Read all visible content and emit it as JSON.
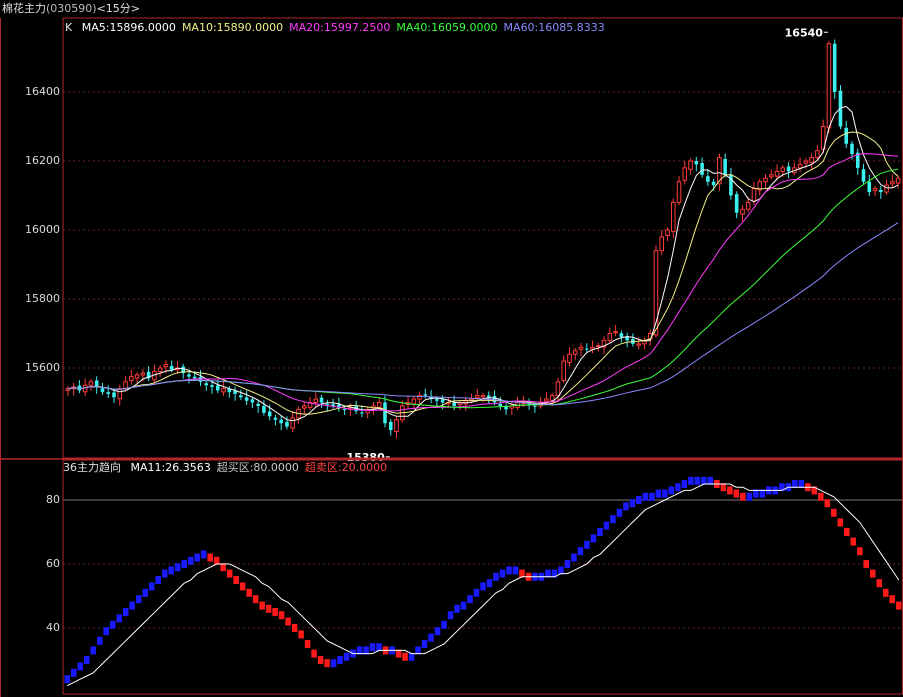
{
  "window": {
    "name": "棉花主力",
    "code": "(030590)",
    "period": "<15分>"
  },
  "colors": {
    "background": "#000000",
    "frame": "#b0262a",
    "grid": "#6e2020",
    "up": "#ff3b3b",
    "down": "#3cf0f0",
    "ma5": "#ffffff",
    "ma10": "#f5f18a",
    "ma20": "#ff3cff",
    "ma40": "#3cff3c",
    "ma60": "#8a8aff",
    "ind_up": "#1a1aff",
    "ind_down": "#ff1a1a",
    "ind_ma": "#ffffff"
  },
  "main_panel": {
    "label": "K",
    "ma_legend": [
      {
        "text": "MA5:15896.0000",
        "color": "#ffffff"
      },
      {
        "text": "MA10:15890.0000",
        "color": "#f5f18a"
      },
      {
        "text": "MA20:15997.2500",
        "color": "#ff3cff"
      },
      {
        "text": "MA40:16059.0000",
        "color": "#3cff3c"
      },
      {
        "text": "MA60:16085.8333",
        "color": "#8a8aff"
      }
    ],
    "high_marker": "16540",
    "low_marker": "15380"
  },
  "sub_panel": {
    "label": "36主力趋向",
    "legend": [
      {
        "text": "MA11:26.3563",
        "color": "#ffffff"
      },
      {
        "text": "超买区:80.0000",
        "color": "#c8c8c8"
      },
      {
        "text": "超卖区:20.0000",
        "color": "#ff4040"
      }
    ]
  },
  "chart_data": [
    {
      "type": "candlestick",
      "title": "",
      "ylim": [
        15380,
        16540
      ],
      "yticks": [
        15600,
        15800,
        16000,
        16200,
        16400
      ],
      "grid": true,
      "close": [
        15540,
        15545,
        15535,
        15550,
        15560,
        15545,
        15530,
        15525,
        15515,
        15540,
        15560,
        15575,
        15580,
        15585,
        15570,
        15590,
        15600,
        15610,
        15595,
        15600,
        15585,
        15575,
        15570,
        15560,
        15550,
        15545,
        15535,
        15540,
        15530,
        15525,
        15515,
        15505,
        15500,
        15490,
        15470,
        15460,
        15450,
        15440,
        15430,
        15455,
        15480,
        15490,
        15500,
        15510,
        15500,
        15495,
        15490,
        15485,
        15480,
        15485,
        15475,
        15470,
        15480,
        15490,
        15500,
        15440,
        15420,
        15450,
        15490,
        15500,
        15510,
        15520,
        15520,
        15510,
        15505,
        15500,
        15500,
        15490,
        15500,
        15505,
        15510,
        15520,
        15520,
        15515,
        15500,
        15490,
        15480,
        15490,
        15500,
        15500,
        15495,
        15490,
        15500,
        15510,
        15520,
        15560,
        15620,
        15640,
        15650,
        15660,
        15655,
        15660,
        15665,
        15680,
        15700,
        15705,
        15690,
        15680,
        15670,
        15670,
        15680,
        15700,
        15940,
        15980,
        16000,
        16080,
        16140,
        16180,
        16200,
        16190,
        16160,
        16140,
        16130,
        16210,
        16160,
        16100,
        16050,
        16060,
        16080,
        16120,
        16140,
        16150,
        16160,
        16170,
        16180,
        16170,
        16180,
        16190,
        16200,
        16210,
        16230,
        16300,
        16540,
        16400,
        16300,
        16250,
        16220,
        16180,
        16140,
        16110,
        16120,
        16110,
        16130,
        16140,
        16150
      ],
      "volume": [],
      "min_max_labels": {
        "high": 16540,
        "low": 15380
      }
    },
    {
      "type": "line",
      "title": "",
      "ylim": [
        20,
        90
      ],
      "yticks": [
        40,
        60,
        80
      ],
      "reference_lines": [
        80
      ],
      "series": [
        {
          "name": "36主力趋向",
          "values": [
            24,
            26,
            28,
            30,
            33,
            36,
            39,
            41,
            43,
            45,
            47,
            49,
            51,
            53,
            55,
            57,
            58,
            59,
            60,
            61,
            62,
            63,
            62,
            61,
            59,
            57,
            55,
            53,
            51,
            49,
            47,
            46,
            45,
            44,
            42,
            40,
            38,
            35,
            32,
            30,
            29,
            29,
            30,
            31,
            32,
            33,
            33,
            34,
            34,
            33,
            33,
            32,
            31,
            31,
            33,
            35,
            37,
            39,
            41,
            44,
            46,
            47,
            49,
            51,
            53,
            54,
            56,
            57,
            58,
            58,
            57,
            56,
            56,
            56,
            57,
            57,
            58,
            60,
            62,
            64,
            66,
            68,
            70,
            72,
            74,
            76,
            78,
            79,
            80,
            81,
            81,
            82,
            82,
            83,
            84,
            85,
            86,
            86,
            86,
            86,
            85,
            84,
            83,
            82,
            81,
            81,
            82,
            82,
            83,
            83,
            84,
            84,
            85,
            85,
            84,
            83,
            81,
            79,
            76,
            73,
            70,
            67,
            64,
            60,
            57,
            54,
            51,
            49,
            47
          ]
        },
        {
          "name": "MA11",
          "values": [
            22,
            23,
            24,
            25,
            26,
            28,
            30,
            32,
            34,
            36,
            38,
            40,
            42,
            44,
            46,
            48,
            50,
            52,
            54,
            55,
            57,
            58,
            59,
            60,
            60,
            60,
            59,
            58,
            57,
            56,
            54,
            53,
            51,
            49,
            48,
            46,
            44,
            42,
            40,
            38,
            36,
            35,
            34,
            33,
            32,
            32,
            32,
            32,
            33,
            33,
            33,
            33,
            33,
            32,
            32,
            32,
            33,
            34,
            35,
            37,
            39,
            41,
            43,
            45,
            47,
            49,
            51,
            52,
            54,
            55,
            56,
            56,
            56,
            56,
            56,
            56,
            57,
            57,
            58,
            59,
            60,
            62,
            63,
            65,
            67,
            69,
            71,
            73,
            75,
            77,
            78,
            79,
            80,
            81,
            82,
            83,
            83,
            84,
            85,
            85,
            85,
            85,
            85,
            84,
            84,
            83,
            83,
            83,
            83,
            83,
            83,
            84,
            84,
            84,
            84,
            84,
            83,
            82,
            81,
            79,
            77,
            75,
            73,
            70,
            67,
            64,
            61,
            58,
            55
          ]
        }
      ]
    }
  ]
}
